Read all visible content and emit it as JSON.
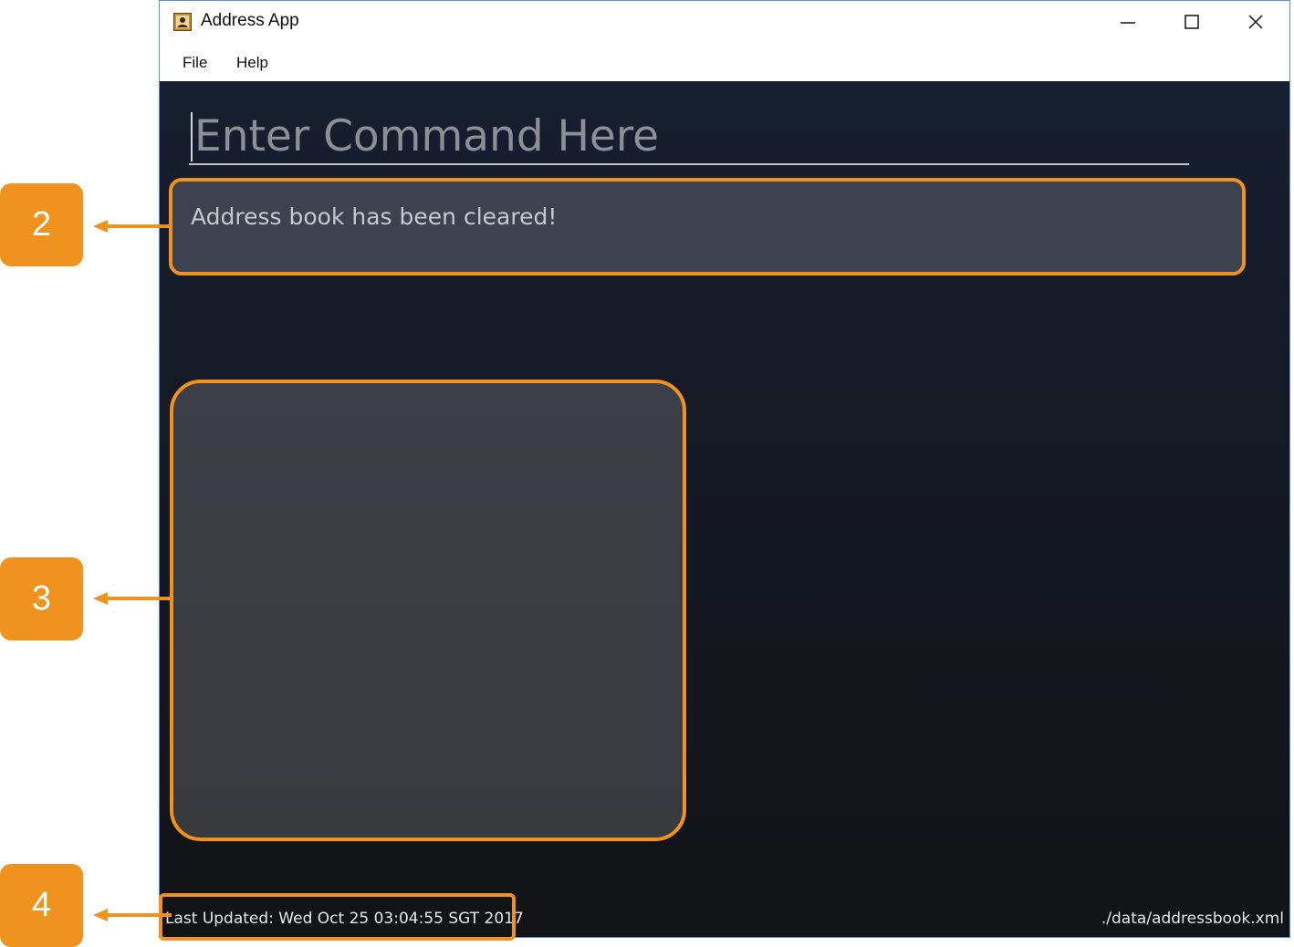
{
  "window": {
    "title": "Address App",
    "icon": "address-book-icon",
    "controls": [
      "minimize-icon",
      "maximize-icon",
      "close-icon"
    ]
  },
  "menu": {
    "items": [
      "File",
      "Help"
    ]
  },
  "command_box": {
    "placeholder": "Enter Command Here",
    "value": ""
  },
  "result_display": {
    "text": "Address book has been cleared!"
  },
  "person_list": {
    "items": []
  },
  "status_bar": {
    "last_updated": "Last Updated: Wed Oct 25 03:04:55 SGT 2017",
    "save_location": "./data/addressbook.xml"
  },
  "callouts": {
    "labels": [
      "2",
      "3",
      "4"
    ]
  },
  "colors": {
    "accent": "#f0921e",
    "background_top": "#171e30",
    "background_bottom": "#121316",
    "panel": "#3d424e"
  }
}
